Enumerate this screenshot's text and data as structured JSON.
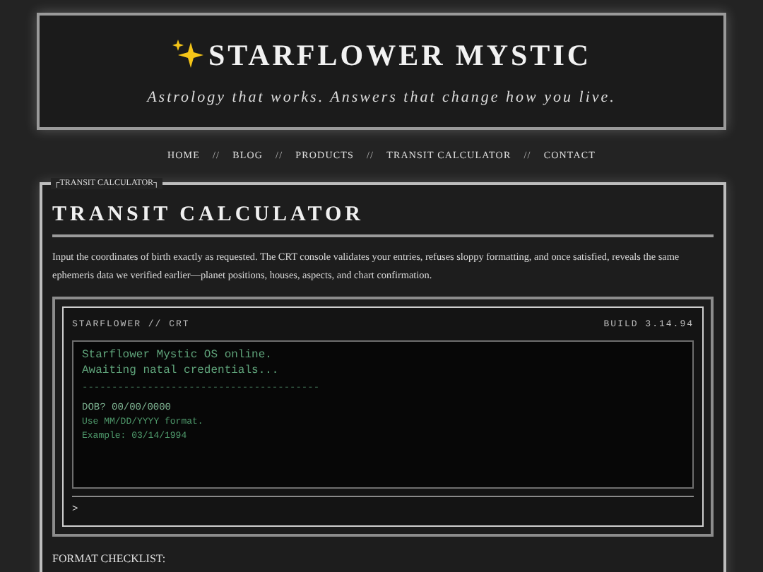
{
  "header": {
    "title": "STARFLOWER MYSTIC",
    "tagline": "Astrology that works. Answers that change how you live."
  },
  "nav": {
    "separator": "//",
    "items": [
      "HOME",
      "BLOG",
      "PRODUCTS",
      "TRANSIT CALCULATOR",
      "CONTACT"
    ]
  },
  "section": {
    "legend": "┌TRANSIT CALCULATOR┐",
    "title": "TRANSIT CALCULATOR",
    "intro": "Input the coordinates of birth exactly as requested. The CRT console validates your entries, refuses sloppy formatting, and once satisfied, reveals the same ephemeris data we verified earlier—planet positions, houses, aspects, and chart confirmation."
  },
  "console": {
    "label": "STARFLOWER // CRT",
    "build": "BUILD 3.14.94",
    "lines": [
      {
        "kind": "text",
        "text": "Starflower Mystic OS online."
      },
      {
        "kind": "text",
        "text": "Awaiting natal credentials..."
      },
      {
        "kind": "rule",
        "text": "----------------------------------------"
      },
      {
        "kind": "prompt",
        "text": "DOB? 00/00/0000"
      },
      {
        "kind": "hint",
        "text": "Use MM/DD/YYYY format."
      },
      {
        "kind": "hint",
        "text": "Example: 03/14/1994"
      }
    ],
    "prompt": ">"
  },
  "checklist": {
    "title": "FORMAT CHECKLIST:"
  }
}
